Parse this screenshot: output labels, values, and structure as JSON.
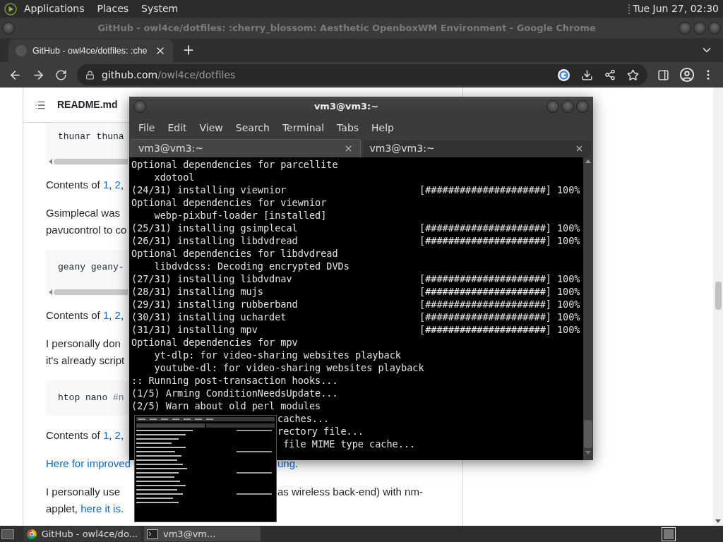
{
  "top_panel": {
    "menus": [
      "Applications",
      "Places",
      "System"
    ],
    "clock": "Tue Jun 27, 02:30"
  },
  "browser": {
    "window_title": "GitHub - owl4ce/dotfiles: :cherry_blossom: Aesthetic OpenboxWM Environment - Google Chrome",
    "tabs": [
      {
        "label": "GitHub - owl4ce/dotfiles: :che",
        "selected": true
      }
    ],
    "address": {
      "host": "github.com",
      "path": "/owl4ce/dotfiles"
    },
    "page": {
      "file_header": "README.md",
      "blocks": [
        {
          "kind": "code",
          "text": "thunar thuna",
          "scrollbar": true
        },
        {
          "kind": "para",
          "lines": [
            {
              "left": [
                {
                  "text": "Contents of "
                },
                {
                  "text": "1",
                  "link": true
                },
                {
                  "text": ", "
                },
                {
                  "text": "2",
                  "link": true
                },
                {
                  "text": ","
                }
              ]
            }
          ]
        },
        {
          "kind": "para",
          "lines": [
            {
              "left": [
                {
                  "text": "Gsimplecal was"
                }
              ]
            },
            {
              "left": [
                {
                  "text": "pavucontrol to co"
                }
              ]
            }
          ]
        },
        {
          "kind": "code",
          "text": "geany geany-",
          "scrollbar": true
        },
        {
          "kind": "para",
          "lines": [
            {
              "left": [
                {
                  "text": "Contents of "
                },
                {
                  "text": "1",
                  "link": true
                },
                {
                  "text": ", "
                },
                {
                  "text": "2",
                  "link": true
                },
                {
                  "text": ","
                }
              ]
            }
          ]
        },
        {
          "kind": "para",
          "lines": [
            {
              "left": [
                {
                  "text": "I personally don"
                }
              ]
            },
            {
              "left": [
                {
                  "text": "it's already script"
                }
              ]
            }
          ]
        },
        {
          "kind": "code",
          "text": "htop nano ",
          "comment": "#n",
          "scrollbar": false
        },
        {
          "kind": "para",
          "lines": [
            {
              "left": [
                {
                  "text": "Contents of "
                },
                {
                  "text": "1",
                  "link": true
                },
                {
                  "text": ", "
                },
                {
                  "text": "2",
                  "link": true
                },
                {
                  "text": ","
                }
              ]
            }
          ]
        },
        {
          "kind": "para",
          "lines": [
            {
              "left": [
                {
                  "text": "Here for improved",
                  "link": true
                }
              ],
              "right": [
                {
                  "text": "ung",
                  "link": true
                },
                {
                  "text": "."
                }
              ]
            }
          ]
        },
        {
          "kind": "para",
          "lines": [
            {
              "left": [
                {
                  "text": "I personally use"
                }
              ],
              "right": [
                {
                  "text": "as wireless back-end) with nm-"
                }
              ]
            },
            {
              "left": [
                {
                  "text": "applet, "
                },
                {
                  "text": "here it is",
                  "link": true
                },
                {
                  "text": "."
                }
              ]
            }
          ]
        }
      ]
    }
  },
  "terminal": {
    "title": "vm3@vm3:~",
    "menus": [
      "File",
      "Edit",
      "View",
      "Search",
      "Terminal",
      "Tabs",
      "Help"
    ],
    "tabs": [
      {
        "label": "vm3@vm3:~",
        "selected": true
      },
      {
        "label": "vm3@vm3:~",
        "selected": false
      }
    ],
    "lines": [
      {
        "kind": "text",
        "text": "Optional dependencies for parcellite"
      },
      {
        "kind": "text",
        "text": "    xdotool"
      },
      {
        "kind": "progress",
        "text": "(24/31) installing viewnior",
        "bar": "[#####################]",
        "percent": "100%"
      },
      {
        "kind": "text",
        "text": "Optional dependencies for viewnior"
      },
      {
        "kind": "text",
        "text": "    webp-pixbuf-loader [installed]"
      },
      {
        "kind": "progress",
        "text": "(25/31) installing gsimplecal",
        "bar": "[#####################]",
        "percent": "100%"
      },
      {
        "kind": "progress",
        "text": "(26/31) installing libdvdread",
        "bar": "[#####################]",
        "percent": "100%"
      },
      {
        "kind": "text",
        "text": "Optional dependencies for libdvdread"
      },
      {
        "kind": "text",
        "text": "    libdvdcss: Decoding encrypted DVDs"
      },
      {
        "kind": "progress",
        "text": "(27/31) installing libdvdnav",
        "bar": "[#####################]",
        "percent": "100%"
      },
      {
        "kind": "progress",
        "text": "(28/31) installing mujs",
        "bar": "[#####################]",
        "percent": "100%"
      },
      {
        "kind": "progress",
        "text": "(29/31) installing rubberband",
        "bar": "[#####################]",
        "percent": "100%"
      },
      {
        "kind": "progress",
        "text": "(30/31) installing uchardet",
        "bar": "[#####################]",
        "percent": "100%"
      },
      {
        "kind": "progress",
        "text": "(31/31) installing mpv",
        "bar": "[#####################]",
        "percent": "100%"
      },
      {
        "kind": "text",
        "text": "Optional dependencies for mpv"
      },
      {
        "kind": "text",
        "text": "    yt-dlp: for video-sharing websites playback"
      },
      {
        "kind": "text",
        "text": "    youtube-dl: for video-sharing websites playback"
      },
      {
        "kind": "text",
        "text": ":: Running post-transaction hooks..."
      },
      {
        "kind": "text",
        "text": "(1/5) Arming ConditionNeedsUpdate..."
      },
      {
        "kind": "text",
        "text": "(2/5) Warn about old perl modules"
      },
      {
        "kind": "covered",
        "text": "caches..."
      },
      {
        "kind": "covered",
        "text": "rectory file..."
      },
      {
        "kind": "covered",
        "text": " file MIME type cache..."
      }
    ]
  },
  "taskbar": {
    "items": [
      {
        "kind": "browser",
        "label": "GitHub - owl4ce/do...",
        "selected": false
      },
      {
        "kind": "terminal",
        "label": "vm3@vm...",
        "selected": true
      }
    ]
  }
}
